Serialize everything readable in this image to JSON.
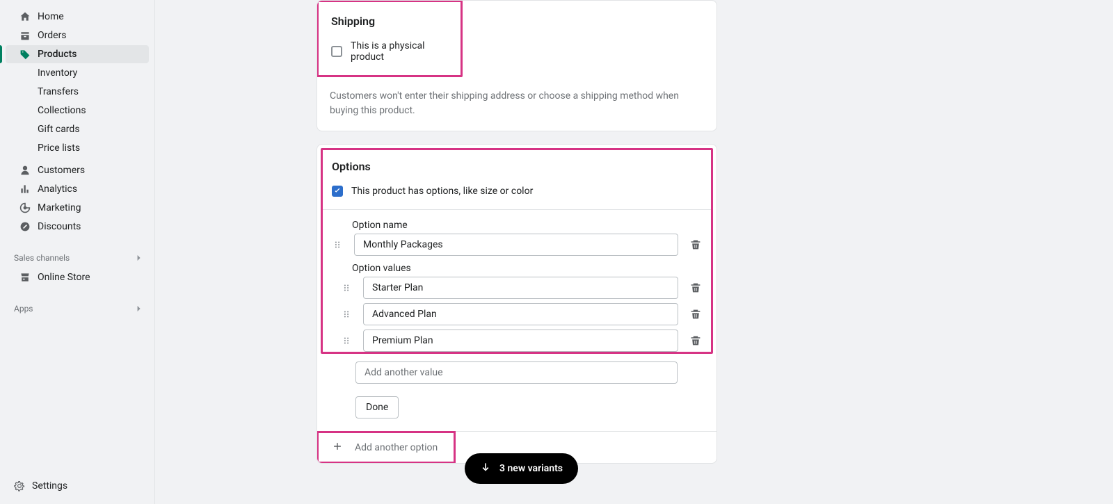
{
  "sidebar": {
    "items": [
      {
        "label": "Home"
      },
      {
        "label": "Orders"
      },
      {
        "label": "Products"
      },
      {
        "label": "Customers"
      },
      {
        "label": "Analytics"
      },
      {
        "label": "Marketing"
      },
      {
        "label": "Discounts"
      }
    ],
    "subitems": [
      {
        "label": "Inventory"
      },
      {
        "label": "Transfers"
      },
      {
        "label": "Collections"
      },
      {
        "label": "Gift cards"
      },
      {
        "label": "Price lists"
      }
    ],
    "sales_channels_label": "Sales channels",
    "online_store_label": "Online Store",
    "apps_label": "Apps",
    "settings_label": "Settings"
  },
  "shipping": {
    "title": "Shipping",
    "checkbox_label": "This is a physical product",
    "helper": "Customers won't enter their shipping address or choose a shipping method when buying this product."
  },
  "options": {
    "title": "Options",
    "checkbox_label": "This product has options, like size or color",
    "option_name_label": "Option name",
    "option_name_value": "Monthly Packages",
    "option_values_label": "Option values",
    "values": [
      "Starter Plan",
      "Advanced Plan",
      "Premium Plan"
    ],
    "add_value_placeholder": "Add another value",
    "done_label": "Done",
    "add_option_label": "Add another option"
  },
  "variants_pill": "3 new variants"
}
